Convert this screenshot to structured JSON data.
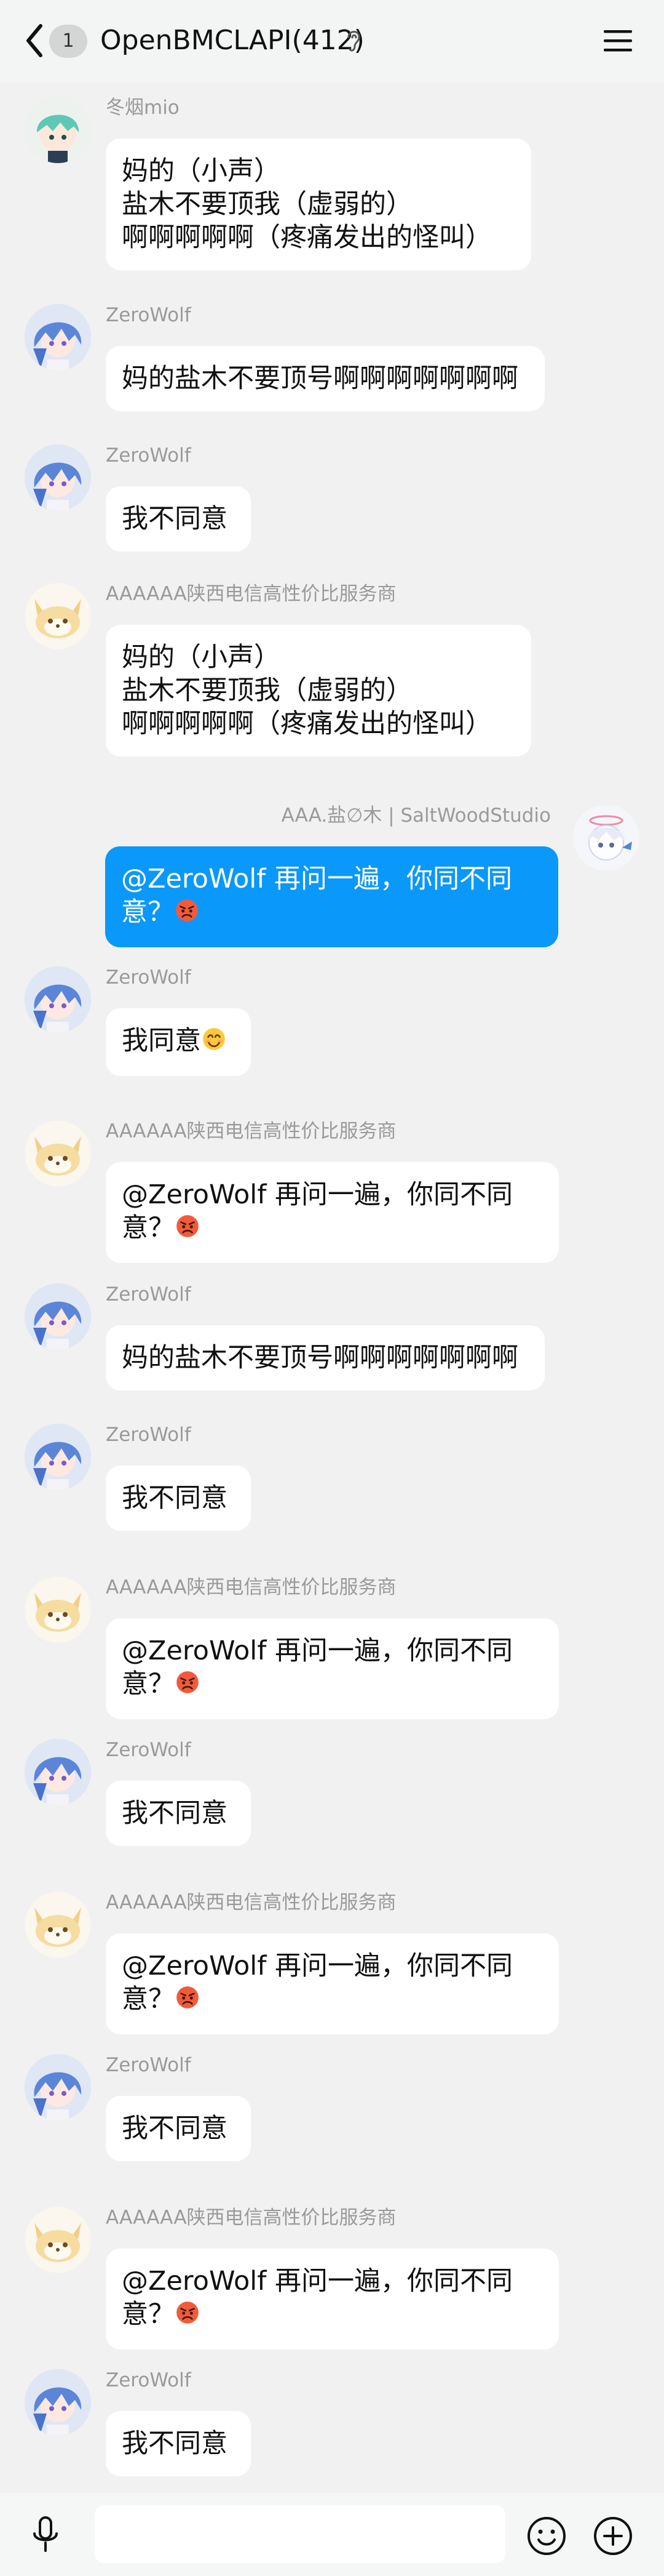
{
  "header": {
    "back_badge": "1",
    "title": "OpenBMCLAPI(412)"
  },
  "messages": [
    {
      "sender": "冬烟mio",
      "avatar": "green-hair-character-avatar",
      "text": "妈的（小声）\n盐木不要顶我（虚弱的）\n啊啊啊啊啊（疼痛发出的怪叫）"
    },
    {
      "sender": "ZeroWolf",
      "avatar": "blue-hair-character-avatar",
      "text": "妈的盐木不要顶号啊啊啊啊啊啊啊"
    },
    {
      "sender": "ZeroWolf",
      "avatar": "blue-hair-character-avatar",
      "text": "我不同意"
    },
    {
      "sender": "AAAAAA陕西电信高性价比服务商",
      "avatar": "fox-avatar",
      "text": "妈的（小声）\n盐木不要顶我（虚弱的）\n啊啊啊啊啊（疼痛发出的怪叫）"
    },
    {
      "sender": "AAA.盐∅木 | SaltWoodStudio",
      "avatar": "halo-character-avatar",
      "self": true,
      "text": "@ZeroWolf 再问一遍，你同不同意？",
      "emoji": "angry-face-emoji"
    },
    {
      "sender": "ZeroWolf",
      "avatar": "blue-hair-character-avatar",
      "text": "我同意",
      "emoji": "smiling-face-emoji"
    },
    {
      "sender": "AAAAAA陕西电信高性价比服务商",
      "avatar": "fox-avatar",
      "text": "@ZeroWolf 再问一遍，你同不同意？",
      "emoji": "angry-face-emoji"
    },
    {
      "sender": "ZeroWolf",
      "avatar": "blue-hair-character-avatar",
      "text": "妈的盐木不要顶号啊啊啊啊啊啊啊"
    },
    {
      "sender": "ZeroWolf",
      "avatar": "blue-hair-character-avatar",
      "text": "我不同意"
    },
    {
      "sender": "AAAAAA陕西电信高性价比服务商",
      "avatar": "fox-avatar",
      "text": "@ZeroWolf 再问一遍，你同不同意？",
      "emoji": "angry-face-emoji"
    },
    {
      "sender": "ZeroWolf",
      "avatar": "blue-hair-character-avatar",
      "text": "我不同意"
    },
    {
      "sender": "AAAAAA陕西电信高性价比服务商",
      "avatar": "fox-avatar",
      "text": "@ZeroWolf 再问一遍，你同不同意？",
      "emoji": "angry-face-emoji"
    },
    {
      "sender": "ZeroWolf",
      "avatar": "blue-hair-character-avatar",
      "text": "我不同意"
    },
    {
      "sender": "AAAAAA陕西电信高性价比服务商",
      "avatar": "fox-avatar",
      "text": "@ZeroWolf 再问一遍，你同不同意？",
      "emoji": "angry-face-emoji"
    },
    {
      "sender": "ZeroWolf",
      "avatar": "blue-hair-character-avatar",
      "text": "我不同意"
    }
  ],
  "input": {
    "value": "",
    "placeholder": ""
  },
  "icons": {
    "back": "chevron-left-icon",
    "ear": "ear-icon",
    "menu": "hamburger-menu-icon",
    "mic": "microphone-icon",
    "emoji": "smiley-face-icon",
    "plus": "plus-circle-icon"
  },
  "colors": {
    "self_bubble": "#0a98fb",
    "other_bubble": "#ffffff",
    "background": "#f0f1f0"
  }
}
